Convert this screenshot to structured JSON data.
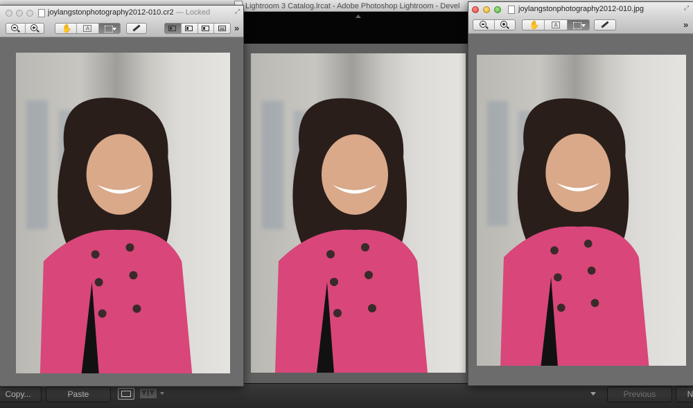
{
  "lightroom": {
    "window_title": "Lightroom 3 Catalog.lrcat - Adobe Photoshop Lightroom - Devel",
    "bottom_bar": {
      "copy_label": "Copy...",
      "paste_label": "Paste",
      "compare_icon_text": "Y|Y",
      "previous_label": "Previous",
      "next_label": "N"
    }
  },
  "preview_left": {
    "title": "joylangstonphotography2012-010.cr2",
    "title_suffix": "— Locked",
    "window_state": "inactive"
  },
  "preview_right": {
    "title": "joylangstonphotography2012-010.jpg",
    "window_state": "active"
  },
  "toolbar": {
    "zoom_out": "zoom-out-icon",
    "zoom_in": "zoom-in-icon",
    "move": "hand-icon",
    "text": "text-select-icon",
    "select": "rect-select-icon",
    "annotate": "pencil-icon",
    "text_icon_glyph": "A"
  },
  "photo": {
    "subject": "girl in pink coat",
    "colors": {
      "coat": "#d8467a",
      "hair": "#2a1e1a",
      "skin": "#d9a98a",
      "wall": "#d4d2ce"
    }
  }
}
